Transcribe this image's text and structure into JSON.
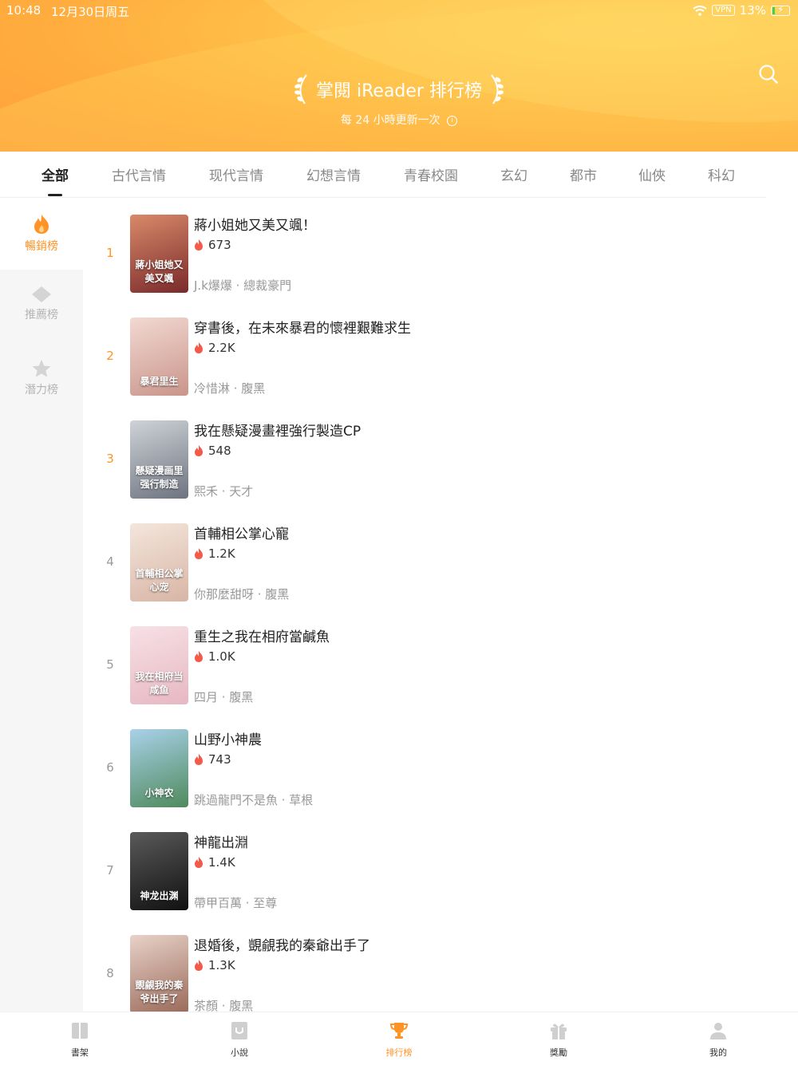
{
  "status": {
    "time": "10:48",
    "date": "12月30日周五",
    "vpn": "VPN",
    "battery": "13%"
  },
  "header": {
    "title": "掌閱 iReader 排行榜",
    "subtitle": "每 24 小時更新一次",
    "search_icon": "search-icon"
  },
  "tabs": [
    "全部",
    "古代言情",
    "现代言情",
    "幻想言情",
    "青春校園",
    "玄幻",
    "都市",
    "仙俠",
    "科幻"
  ],
  "sidebar": [
    {
      "label": "暢銷榜",
      "icon": "flame-icon"
    },
    {
      "label": "推薦榜",
      "icon": "diamond-icon"
    },
    {
      "label": "潛力榜",
      "icon": "star-icon"
    }
  ],
  "books": [
    {
      "rank": "1",
      "title": "蔣小姐她又美又颯！",
      "heat": "673",
      "meta": "J.k爆爆 · 總裁豪門",
      "cover_text": "蔣小姐她又美又颯",
      "colors": [
        "#d98a6a",
        "#7a2a2a"
      ]
    },
    {
      "rank": "2",
      "title": "穿書後，在未來暴君的懷裡艱難求生",
      "heat": "2.2K",
      "meta": "冷惜淋 · 腹黑",
      "cover_text": "暴君里生",
      "colors": [
        "#f2d9d2",
        "#c9958a"
      ]
    },
    {
      "rank": "3",
      "title": "我在懸疑漫畫裡強行製造CP",
      "heat": "548",
      "meta": "熙禾 · 天才",
      "cover_text": "懸疑漫画里强行制造",
      "colors": [
        "#cfd3d8",
        "#6e7480"
      ]
    },
    {
      "rank": "4",
      "title": "首輔相公掌心寵",
      "heat": "1.2K",
      "meta": "你那麼甜呀 · 腹黑",
      "cover_text": "首輔相公掌心宠",
      "colors": [
        "#f3e6dc",
        "#d8b5a5"
      ]
    },
    {
      "rank": "5",
      "title": "重生之我在相府當鹹魚",
      "heat": "1.0K",
      "meta": "四月 · 腹黑",
      "cover_text": "我在相府当咸鱼",
      "colors": [
        "#f7e1e6",
        "#e7b7c2"
      ]
    },
    {
      "rank": "6",
      "title": "山野小神農",
      "heat": "743",
      "meta": "跳過龍門不是魚 · 草根",
      "cover_text": "小神农",
      "colors": [
        "#a9d1ea",
        "#4f8a5c"
      ]
    },
    {
      "rank": "7",
      "title": "神龍出淵",
      "heat": "1.4K",
      "meta": "帶甲百萬 · 至尊",
      "cover_text": "神龙出渊",
      "colors": [
        "#5a5a5a",
        "#111111"
      ]
    },
    {
      "rank": "8",
      "title": "退婚後，覬覦我的秦爺出手了",
      "heat": "1.3K",
      "meta": "茶顏 · 腹黑",
      "cover_text": "覬覦我的秦爷出手了",
      "colors": [
        "#e8d2c8",
        "#9a6a5a"
      ]
    }
  ],
  "bottom_nav": [
    {
      "label": "書架",
      "icon": "bookshelf-icon"
    },
    {
      "label": "小說",
      "icon": "novel-icon"
    },
    {
      "label": "排行榜",
      "icon": "trophy-icon"
    },
    {
      "label": "獎勵",
      "icon": "gift-icon"
    },
    {
      "label": "我的",
      "icon": "profile-icon"
    }
  ],
  "colors": {
    "accent": "#ff9326",
    "header_start": "#ffd45c",
    "header_end": "#ff9e3a"
  }
}
